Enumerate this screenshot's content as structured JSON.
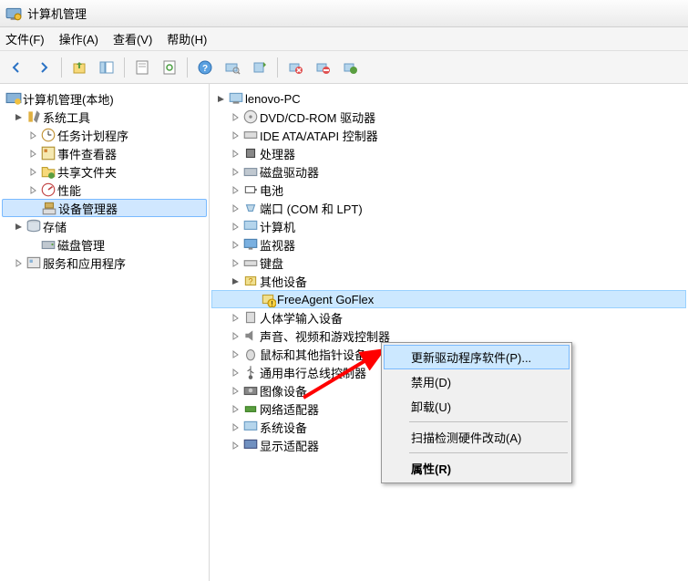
{
  "window": {
    "title": "计算机管理"
  },
  "menu": {
    "file": "文件(F)",
    "action": "操作(A)",
    "view": "查看(V)",
    "help": "帮助(H)"
  },
  "left_tree": {
    "root": "计算机管理(本地)",
    "system_tools": "系统工具",
    "task_scheduler": "任务计划程序",
    "event_viewer": "事件查看器",
    "shared_folders": "共享文件夹",
    "performance": "性能",
    "device_manager": "设备管理器",
    "storage": "存储",
    "disk_management": "磁盘管理",
    "services_apps": "服务和应用程序"
  },
  "right_tree": {
    "root": "lenovo-PC",
    "dvd": "DVD/CD-ROM 驱动器",
    "ide": "IDE ATA/ATAPI 控制器",
    "processors": "处理器",
    "disk_drives": "磁盘驱动器",
    "batteries": "电池",
    "ports": "端口 (COM 和 LPT)",
    "computer": "计算机",
    "monitors": "监视器",
    "keyboards": "键盘",
    "other_devices": "其他设备",
    "freeagent": "FreeAgent GoFlex",
    "hid": "人体学输入设备",
    "sound": "声音、视频和游戏控制器",
    "mouse": "鼠标和其他指针设备",
    "usb": "通用串行总线控制器",
    "imaging": "图像设备",
    "network": "网络适配器",
    "system_devices": "系统设备",
    "display": "显示适配器"
  },
  "context_menu": {
    "update": "更新驱动程序软件(P)...",
    "disable": "禁用(D)",
    "uninstall": "卸载(U)",
    "scan": "扫描检测硬件改动(A)",
    "properties": "属性(R)"
  }
}
